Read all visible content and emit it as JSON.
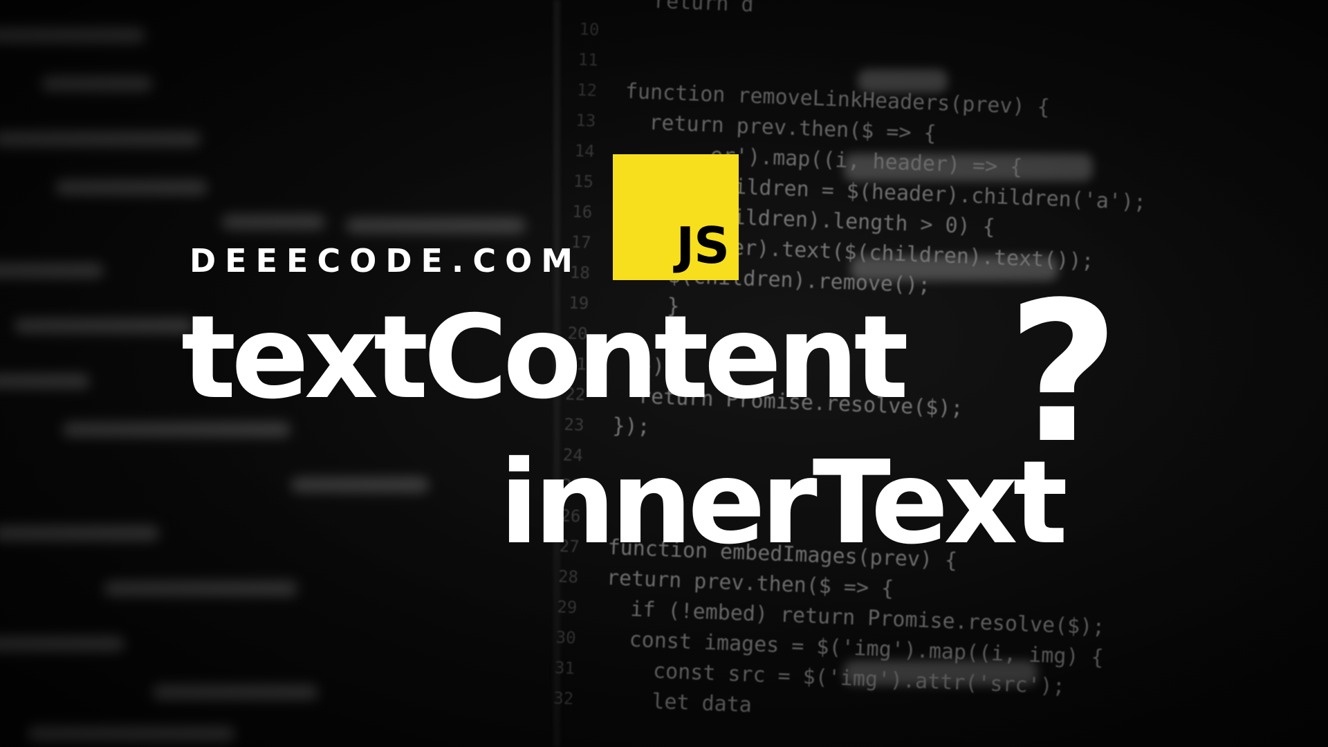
{
  "brand": {
    "site": "DEEECODE.COM"
  },
  "badge": {
    "label": "JS",
    "color": "#f7df1e"
  },
  "headline": {
    "line1": "textContent",
    "mark": "?",
    "line2": "innerText"
  },
  "background_code": [
    {
      "num": "",
      "src": "  return d"
    },
    {
      "num": "10",
      "src": ""
    },
    {
      "num": "11",
      "src": ""
    },
    {
      "num": "12",
      "src": "function removeLinkHeaders(prev) {"
    },
    {
      "num": "13",
      "src": "  return prev.then($ => {"
    },
    {
      "num": "14",
      "src": "       er').map((i, header) => {"
    },
    {
      "num": "15",
      "src": "       children = $(header).children('a');"
    },
    {
      "num": "16",
      "src": "       children).length > 0) {"
    },
    {
      "num": "17",
      "src": "       ader).text($(children).text());"
    },
    {
      "num": "18",
      "src": "    $(children).remove();"
    },
    {
      "num": "19",
      "src": "    }"
    },
    {
      "num": "20",
      "src": ""
    },
    {
      "num": "21",
      "src": "  });"
    },
    {
      "num": "22",
      "src": "  return Promise.resolve($);"
    },
    {
      "num": "23",
      "src": "});"
    },
    {
      "num": "24",
      "src": ""
    },
    {
      "num": "25",
      "src": ""
    },
    {
      "num": "26",
      "src": ""
    },
    {
      "num": "27",
      "src": "function embedImages(prev) {"
    },
    {
      "num": "28",
      "src": "return prev.then($ => {"
    },
    {
      "num": "29",
      "src": "  if (!embed) return Promise.resolve($);"
    },
    {
      "num": "30",
      "src": "  const images = $('img').map((i, img) {"
    },
    {
      "num": "31",
      "src": "    const src = $('img').attr('src');"
    },
    {
      "num": "32",
      "src": "    let data"
    }
  ]
}
